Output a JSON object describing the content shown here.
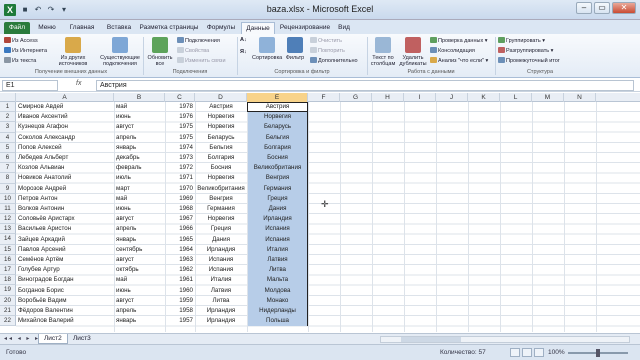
{
  "window": {
    "title": "baza.xlsx - Microsoft Excel",
    "app_letter": "X"
  },
  "ribbon_tabs": [
    "Файл",
    "Меню",
    "Главная",
    "Вставка",
    "Разметка страницы",
    "Формулы",
    "Данные",
    "Рецензирование",
    "Вид"
  ],
  "active_tab": "Данные",
  "ribbon": {
    "ext_data": {
      "access": "Из Access",
      "web": "Из Интернета",
      "text": "Из текста",
      "other": "Из других источников",
      "existing": "Существующие подключения",
      "label": "Получение внешних данных"
    },
    "connections": {
      "refresh": "Обновить все",
      "connections": "Подключения",
      "properties": "Свойства",
      "edit_links": "Изменить связи",
      "label": "Подключения"
    },
    "sort_filter": {
      "sort": "Сортировка",
      "filter": "Фильтр",
      "clear": "Очистить",
      "reapply": "Повторить",
      "advanced": "Дополнительно",
      "label": "Сортировка и фильтр"
    },
    "data_tools": {
      "text_to_columns": "Текст по столбцам",
      "remove_dupes": "Удалить дубликаты",
      "validation": "Проверка данных",
      "consolidate": "Консолидация",
      "whatif": "Анализ \"что если\"",
      "label": "Работа с данными"
    },
    "outline": {
      "group": "Группировать",
      "ungroup": "Разгруппировать",
      "subtotal": "Промежуточный итог",
      "label": "Структура"
    }
  },
  "formula_bar": {
    "name_box": "E1",
    "fx": "fx",
    "value": "Австрия"
  },
  "columns": [
    "A",
    "B",
    "C",
    "D",
    "E",
    "F",
    "G",
    "H",
    "I",
    "J",
    "K",
    "L",
    "M",
    "N"
  ],
  "rows": [
    {
      "n": "1",
      "name": "Смирнов Авдей",
      "month": "май",
      "year": "1978",
      "country": "Австрия",
      "e": "Австрия"
    },
    {
      "n": "2",
      "name": "Иванов Аксентий",
      "month": "июнь",
      "year": "1976",
      "country": "Норвегия",
      "e": "Норвегия"
    },
    {
      "n": "3",
      "name": "Кузнецов Агафон",
      "month": "август",
      "year": "1975",
      "country": "Норвегия",
      "e": "Беларусь"
    },
    {
      "n": "4",
      "name": "Соколов Александр",
      "month": "апрель",
      "year": "1975",
      "country": "Беларусь",
      "e": "Бельгия"
    },
    {
      "n": "5",
      "name": "Попов Алексей",
      "month": "январь",
      "year": "1974",
      "country": "Бельгия",
      "e": "Болгария"
    },
    {
      "n": "6",
      "name": "Лебедев Альберт",
      "month": "декабрь",
      "year": "1973",
      "country": "Болгария",
      "e": "Босния"
    },
    {
      "n": "7",
      "name": "Козлов Альвиан",
      "month": "февраль",
      "year": "1972",
      "country": "Босния",
      "e": "Великобритания"
    },
    {
      "n": "8",
      "name": "Новиков Анатолий",
      "month": "июль",
      "year": "1971",
      "country": "Норвегия",
      "e": "Венгрия"
    },
    {
      "n": "9",
      "name": "Морозов Андрей",
      "month": "март",
      "year": "1970",
      "country": "Великобритания",
      "e": "Германия"
    },
    {
      "n": "10",
      "name": "Петров Антон",
      "month": "май",
      "year": "1969",
      "country": "Венгрия",
      "e": "Греция"
    },
    {
      "n": "11",
      "name": "Волков Антонин",
      "month": "июнь",
      "year": "1968",
      "country": "Германия",
      "e": "Дания"
    },
    {
      "n": "12",
      "name": "Соловьёв Аристарх",
      "month": "август",
      "year": "1967",
      "country": "Норвегия",
      "e": "Ирландия"
    },
    {
      "n": "13",
      "name": "Васильев Аристон",
      "month": "апрель",
      "year": "1966",
      "country": "Греция",
      "e": "Испания"
    },
    {
      "n": "14",
      "name": "Зайцев Аркадий",
      "month": "январь",
      "year": "1965",
      "country": "Дания",
      "e": "Испания"
    },
    {
      "n": "15",
      "name": "Павлов Арсений",
      "month": "сентябрь",
      "year": "1964",
      "country": "Ирландия",
      "e": "Италия"
    },
    {
      "n": "16",
      "name": "Семёнов Артём",
      "month": "август",
      "year": "1963",
      "country": "Испания",
      "e": "Латвия"
    },
    {
      "n": "17",
      "name": "Голубев Артур",
      "month": "октябрь",
      "year": "1962",
      "country": "Испания",
      "e": "Литва"
    },
    {
      "n": "18",
      "name": "Виноградов Богдан",
      "month": "май",
      "year": "1961",
      "country": "Италия",
      "e": "Мальта"
    },
    {
      "n": "19",
      "name": "Богданов Борис",
      "month": "июнь",
      "year": "1960",
      "country": "Латвия",
      "e": "Молдова"
    },
    {
      "n": "20",
      "name": "Воробьёв Вадим",
      "month": "август",
      "year": "1959",
      "country": "Литва",
      "e": "Монако"
    },
    {
      "n": "21",
      "name": "Фёдоров Валентин",
      "month": "апрель",
      "year": "1958",
      "country": "Ирландия",
      "e": "Нидерланды"
    },
    {
      "n": "22",
      "name": "Михайлов Валерий",
      "month": "январь",
      "year": "1957",
      "country": "Ирландия",
      "e": "Польша"
    }
  ],
  "sheets": [
    "Лист2",
    "Лист3"
  ],
  "active_sheet": "Лист2",
  "status": {
    "ready": "Готово",
    "count": "Количество: 57",
    "zoom": "100%"
  },
  "colors": {
    "accent": "#2a7b3c",
    "selection": "#b7cde8",
    "header_sel": "#f8d38a"
  }
}
